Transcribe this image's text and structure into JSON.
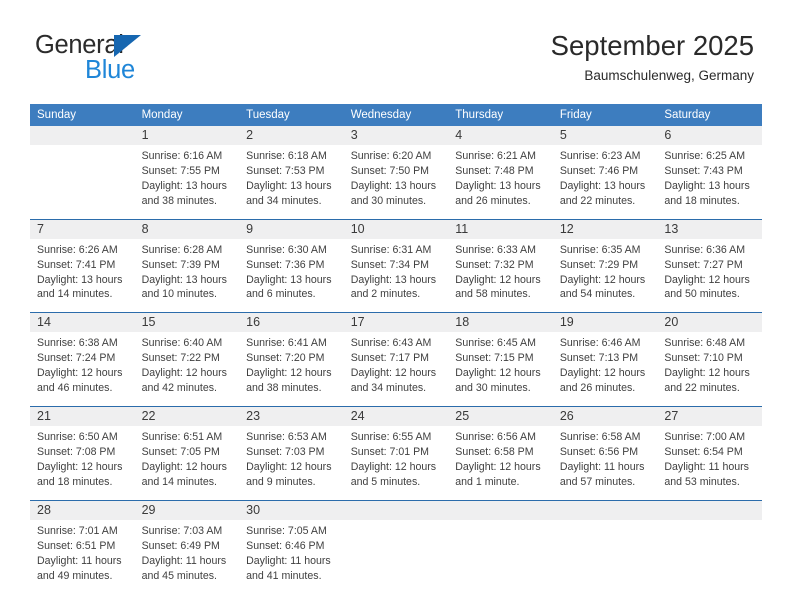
{
  "brand": {
    "name_part1": "General",
    "name_part2": "Blue",
    "triangle_icon": "triangle-icon",
    "color_dark": "#2b2b2b",
    "color_blue": "#1f86d8",
    "color_triangle": "#1666b0"
  },
  "header": {
    "month_title": "September 2025",
    "location": "Baumschulenweg, Germany"
  },
  "theme": {
    "header_bar": "#3d7dbf",
    "row_divider": "#2b6cab",
    "daynum_band": "#efeff0"
  },
  "weekdays": [
    "Sunday",
    "Monday",
    "Tuesday",
    "Wednesday",
    "Thursday",
    "Friday",
    "Saturday"
  ],
  "weeks": [
    {
      "days": [
        {
          "num": "",
          "empty": true
        },
        {
          "num": "1",
          "sunrise": "Sunrise: 6:16 AM",
          "sunset": "Sunset: 7:55 PM",
          "daylight1": "Daylight: 13 hours",
          "daylight2": "and 38 minutes."
        },
        {
          "num": "2",
          "sunrise": "Sunrise: 6:18 AM",
          "sunset": "Sunset: 7:53 PM",
          "daylight1": "Daylight: 13 hours",
          "daylight2": "and 34 minutes."
        },
        {
          "num": "3",
          "sunrise": "Sunrise: 6:20 AM",
          "sunset": "Sunset: 7:50 PM",
          "daylight1": "Daylight: 13 hours",
          "daylight2": "and 30 minutes."
        },
        {
          "num": "4",
          "sunrise": "Sunrise: 6:21 AM",
          "sunset": "Sunset: 7:48 PM",
          "daylight1": "Daylight: 13 hours",
          "daylight2": "and 26 minutes."
        },
        {
          "num": "5",
          "sunrise": "Sunrise: 6:23 AM",
          "sunset": "Sunset: 7:46 PM",
          "daylight1": "Daylight: 13 hours",
          "daylight2": "and 22 minutes."
        },
        {
          "num": "6",
          "sunrise": "Sunrise: 6:25 AM",
          "sunset": "Sunset: 7:43 PM",
          "daylight1": "Daylight: 13 hours",
          "daylight2": "and 18 minutes."
        }
      ]
    },
    {
      "days": [
        {
          "num": "7",
          "sunrise": "Sunrise: 6:26 AM",
          "sunset": "Sunset: 7:41 PM",
          "daylight1": "Daylight: 13 hours",
          "daylight2": "and 14 minutes."
        },
        {
          "num": "8",
          "sunrise": "Sunrise: 6:28 AM",
          "sunset": "Sunset: 7:39 PM",
          "daylight1": "Daylight: 13 hours",
          "daylight2": "and 10 minutes."
        },
        {
          "num": "9",
          "sunrise": "Sunrise: 6:30 AM",
          "sunset": "Sunset: 7:36 PM",
          "daylight1": "Daylight: 13 hours",
          "daylight2": "and 6 minutes."
        },
        {
          "num": "10",
          "sunrise": "Sunrise: 6:31 AM",
          "sunset": "Sunset: 7:34 PM",
          "daylight1": "Daylight: 13 hours",
          "daylight2": "and 2 minutes."
        },
        {
          "num": "11",
          "sunrise": "Sunrise: 6:33 AM",
          "sunset": "Sunset: 7:32 PM",
          "daylight1": "Daylight: 12 hours",
          "daylight2": "and 58 minutes."
        },
        {
          "num": "12",
          "sunrise": "Sunrise: 6:35 AM",
          "sunset": "Sunset: 7:29 PM",
          "daylight1": "Daylight: 12 hours",
          "daylight2": "and 54 minutes."
        },
        {
          "num": "13",
          "sunrise": "Sunrise: 6:36 AM",
          "sunset": "Sunset: 7:27 PM",
          "daylight1": "Daylight: 12 hours",
          "daylight2": "and 50 minutes."
        }
      ]
    },
    {
      "days": [
        {
          "num": "14",
          "sunrise": "Sunrise: 6:38 AM",
          "sunset": "Sunset: 7:24 PM",
          "daylight1": "Daylight: 12 hours",
          "daylight2": "and 46 minutes."
        },
        {
          "num": "15",
          "sunrise": "Sunrise: 6:40 AM",
          "sunset": "Sunset: 7:22 PM",
          "daylight1": "Daylight: 12 hours",
          "daylight2": "and 42 minutes."
        },
        {
          "num": "16",
          "sunrise": "Sunrise: 6:41 AM",
          "sunset": "Sunset: 7:20 PM",
          "daylight1": "Daylight: 12 hours",
          "daylight2": "and 38 minutes."
        },
        {
          "num": "17",
          "sunrise": "Sunrise: 6:43 AM",
          "sunset": "Sunset: 7:17 PM",
          "daylight1": "Daylight: 12 hours",
          "daylight2": "and 34 minutes."
        },
        {
          "num": "18",
          "sunrise": "Sunrise: 6:45 AM",
          "sunset": "Sunset: 7:15 PM",
          "daylight1": "Daylight: 12 hours",
          "daylight2": "and 30 minutes."
        },
        {
          "num": "19",
          "sunrise": "Sunrise: 6:46 AM",
          "sunset": "Sunset: 7:13 PM",
          "daylight1": "Daylight: 12 hours",
          "daylight2": "and 26 minutes."
        },
        {
          "num": "20",
          "sunrise": "Sunrise: 6:48 AM",
          "sunset": "Sunset: 7:10 PM",
          "daylight1": "Daylight: 12 hours",
          "daylight2": "and 22 minutes."
        }
      ]
    },
    {
      "days": [
        {
          "num": "21",
          "sunrise": "Sunrise: 6:50 AM",
          "sunset": "Sunset: 7:08 PM",
          "daylight1": "Daylight: 12 hours",
          "daylight2": "and 18 minutes."
        },
        {
          "num": "22",
          "sunrise": "Sunrise: 6:51 AM",
          "sunset": "Sunset: 7:05 PM",
          "daylight1": "Daylight: 12 hours",
          "daylight2": "and 14 minutes."
        },
        {
          "num": "23",
          "sunrise": "Sunrise: 6:53 AM",
          "sunset": "Sunset: 7:03 PM",
          "daylight1": "Daylight: 12 hours",
          "daylight2": "and 9 minutes."
        },
        {
          "num": "24",
          "sunrise": "Sunrise: 6:55 AM",
          "sunset": "Sunset: 7:01 PM",
          "daylight1": "Daylight: 12 hours",
          "daylight2": "and 5 minutes."
        },
        {
          "num": "25",
          "sunrise": "Sunrise: 6:56 AM",
          "sunset": "Sunset: 6:58 PM",
          "daylight1": "Daylight: 12 hours",
          "daylight2": "and 1 minute."
        },
        {
          "num": "26",
          "sunrise": "Sunrise: 6:58 AM",
          "sunset": "Sunset: 6:56 PM",
          "daylight1": "Daylight: 11 hours",
          "daylight2": "and 57 minutes."
        },
        {
          "num": "27",
          "sunrise": "Sunrise: 7:00 AM",
          "sunset": "Sunset: 6:54 PM",
          "daylight1": "Daylight: 11 hours",
          "daylight2": "and 53 minutes."
        }
      ]
    },
    {
      "days": [
        {
          "num": "28",
          "sunrise": "Sunrise: 7:01 AM",
          "sunset": "Sunset: 6:51 PM",
          "daylight1": "Daylight: 11 hours",
          "daylight2": "and 49 minutes."
        },
        {
          "num": "29",
          "sunrise": "Sunrise: 7:03 AM",
          "sunset": "Sunset: 6:49 PM",
          "daylight1": "Daylight: 11 hours",
          "daylight2": "and 45 minutes."
        },
        {
          "num": "30",
          "sunrise": "Sunrise: 7:05 AM",
          "sunset": "Sunset: 6:46 PM",
          "daylight1": "Daylight: 11 hours",
          "daylight2": "and 41 minutes."
        },
        {
          "num": "",
          "empty": true
        },
        {
          "num": "",
          "empty": true
        },
        {
          "num": "",
          "empty": true
        },
        {
          "num": "",
          "empty": true
        }
      ]
    }
  ]
}
